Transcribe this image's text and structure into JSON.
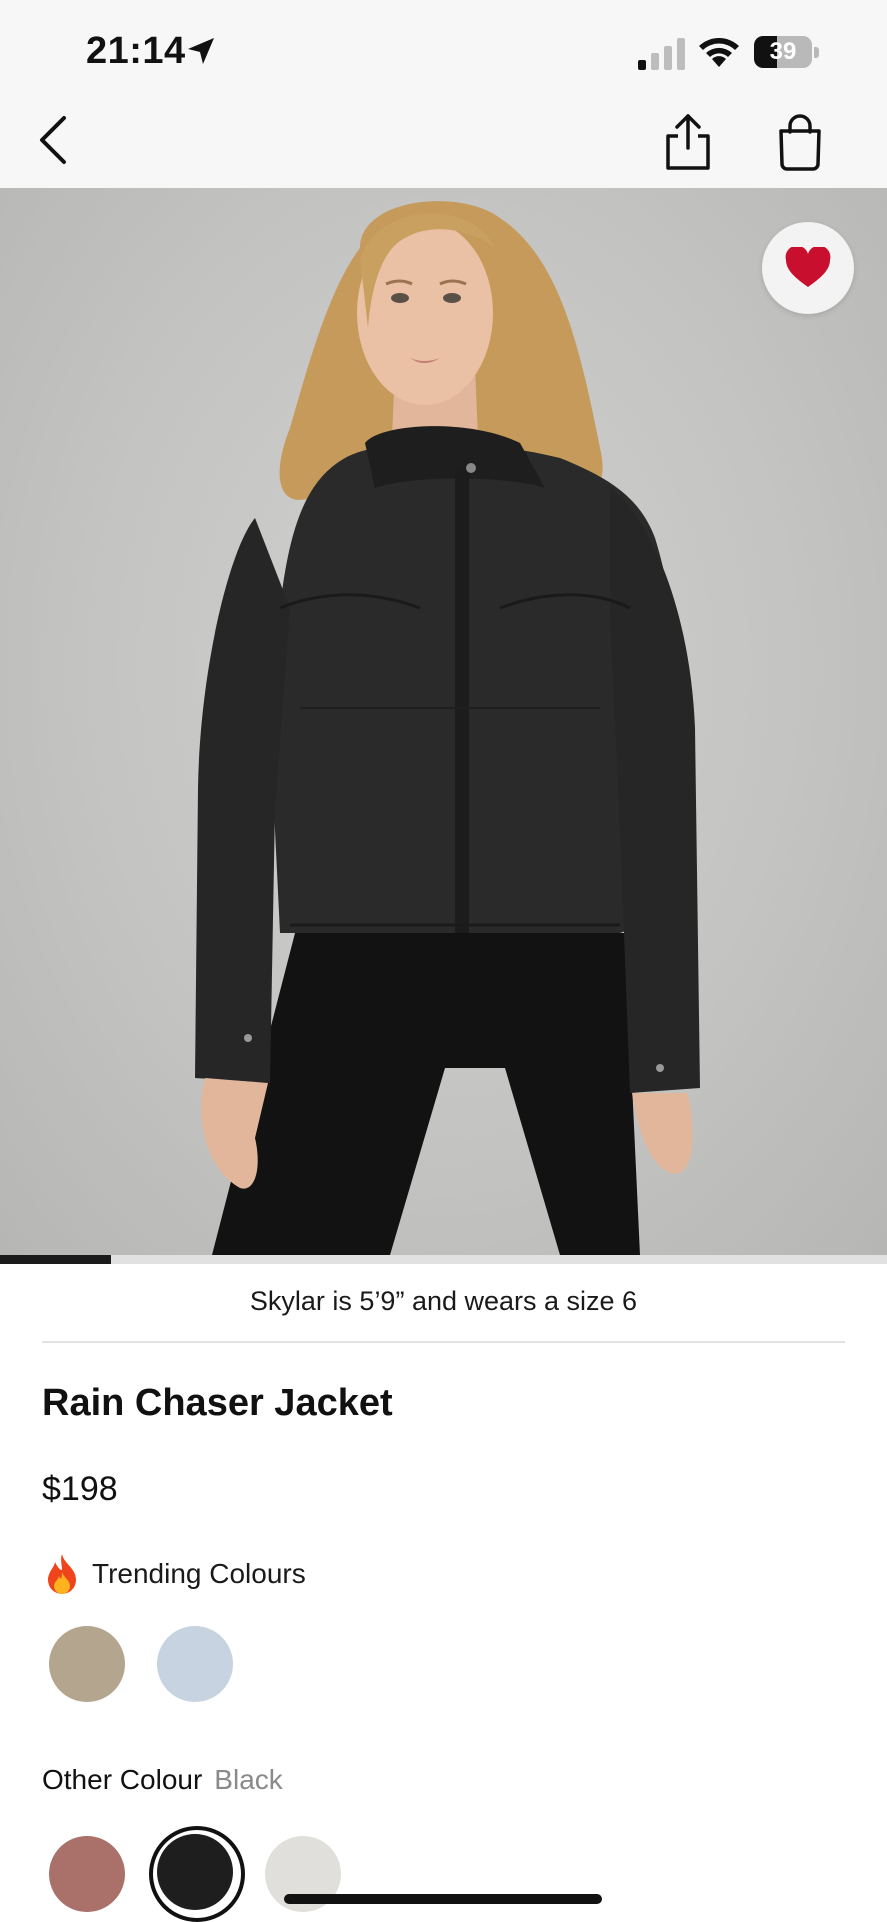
{
  "status_bar": {
    "time": "21:14",
    "battery_level": "39",
    "icons": [
      "location-arrow-icon",
      "signal-icon",
      "wifi-icon",
      "battery-icon"
    ]
  },
  "nav": {
    "icons": [
      "back-chevron-icon",
      "share-icon",
      "shopping-bag-icon"
    ]
  },
  "gallery": {
    "favorite_icon": "heart-icon",
    "favorite_color": "#c8102e",
    "progress": 0.125
  },
  "product": {
    "model_note": "Skylar is 5’9” and wears a size 6",
    "title": "Rain Chaser Jacket",
    "price": "$198"
  },
  "trending": {
    "icon": "fire-icon",
    "label": "Trending Colours",
    "swatches": [
      {
        "name": "trending-swatch-taupe",
        "color": "#b4a58f"
      },
      {
        "name": "trending-swatch-light-blue",
        "color": "#c7d3e0"
      }
    ]
  },
  "other_colour": {
    "label": "Other Colour",
    "selected": "Black",
    "swatches": [
      {
        "name": "colour-swatch-rose-brown",
        "color": "#a9716a"
      },
      {
        "name": "colour-swatch-black",
        "color": "#1e1e1e",
        "selected": true
      },
      {
        "name": "colour-swatch-light-grey",
        "color": "#e1dfdb"
      }
    ]
  }
}
